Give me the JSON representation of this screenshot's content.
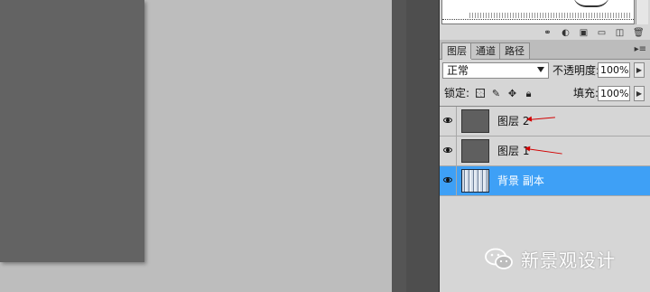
{
  "panel": {
    "tabs": [
      {
        "label": "图层",
        "active": true
      },
      {
        "label": "通道",
        "active": false
      },
      {
        "label": "路径",
        "active": false
      }
    ],
    "close_glyph": "▸≡"
  },
  "controls": {
    "blend_mode": "正常",
    "opacity_label": "不透明度:",
    "opacity_value": "100%",
    "lock_label": "锁定:",
    "fill_label": "填充:",
    "fill_value": "100%",
    "lock_icons": [
      "lock-transparent-icon",
      "brush-icon",
      "move-icon",
      "lock-icon"
    ]
  },
  "layers": [
    {
      "name": "图层 2",
      "visible": true,
      "selected": false
    },
    {
      "name": "图层 1",
      "visible": true,
      "selected": false
    },
    {
      "name": "背景 副本",
      "visible": true,
      "selected": true
    }
  ],
  "watermark": {
    "text": "新景观设计"
  },
  "colors": {
    "selection": "#3ea0f6",
    "annotation_arrow": "#d20000",
    "panel_bg": "#d6d6d6",
    "canvas_gray": "#636363"
  }
}
